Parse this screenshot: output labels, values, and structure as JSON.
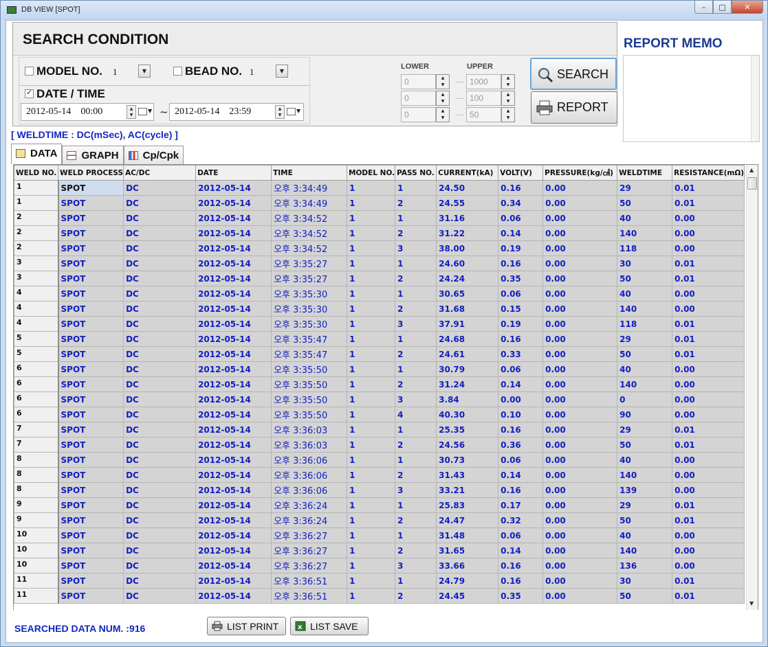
{
  "window": {
    "title": "DB VIEW [SPOT]",
    "minimize": "–",
    "maximize": "□",
    "close": "✕"
  },
  "search": {
    "title": "SEARCH CONDITION",
    "model_label": "MODEL NO.",
    "model_value": "1",
    "model_checked": false,
    "bead_label": "BEAD NO.",
    "bead_value": "1",
    "bead_checked": false,
    "datetime_label": "DATE / TIME",
    "datetime_checked": true,
    "from": "2012-05-14    00:00",
    "to": "2012-05-14    23:59",
    "tilde": "~",
    "lower_label": "LOWER",
    "upper_label": "UPPER",
    "lower": [
      "0",
      "0",
      "0"
    ],
    "upper": [
      "1000",
      "100",
      "50"
    ],
    "search_button": "SEARCH",
    "report_button": "REPORT"
  },
  "memo": {
    "title": "REPORT MEMO"
  },
  "weldtime_note": "[ WELDTIME : DC(mSec), AC(cycle) ]",
  "tabs": [
    "DATA",
    "GRAPH",
    "Cp/Cpk"
  ],
  "grid": {
    "columns": [
      "WELD NO.",
      "WELD PROCESS",
      "AC/DC",
      "DATE",
      "TIME",
      "MODEL NO.",
      "PASS NO.",
      "CURRENT(kA)",
      "VOLT(V)",
      "PRESSURE(kg/㎠)",
      "WELDTIME",
      "RESISTANCE(mΩ)"
    ],
    "rows": [
      [
        "1",
        "SPOT",
        "DC",
        "2012-05-14",
        "오후 3:34:49",
        "1",
        "1",
        "24.50",
        "0.16",
        "0.00",
        "29",
        "0.01"
      ],
      [
        "1",
        "SPOT",
        "DC",
        "2012-05-14",
        "오후 3:34:49",
        "1",
        "2",
        "24.55",
        "0.34",
        "0.00",
        "50",
        "0.01"
      ],
      [
        "2",
        "SPOT",
        "DC",
        "2012-05-14",
        "오후 3:34:52",
        "1",
        "1",
        "31.16",
        "0.06",
        "0.00",
        "40",
        "0.00"
      ],
      [
        "2",
        "SPOT",
        "DC",
        "2012-05-14",
        "오후 3:34:52",
        "1",
        "2",
        "31.22",
        "0.14",
        "0.00",
        "140",
        "0.00"
      ],
      [
        "2",
        "SPOT",
        "DC",
        "2012-05-14",
        "오후 3:34:52",
        "1",
        "3",
        "38.00",
        "0.19",
        "0.00",
        "118",
        "0.00"
      ],
      [
        "3",
        "SPOT",
        "DC",
        "2012-05-14",
        "오후 3:35:27",
        "1",
        "1",
        "24.60",
        "0.16",
        "0.00",
        "30",
        "0.01"
      ],
      [
        "3",
        "SPOT",
        "DC",
        "2012-05-14",
        "오후 3:35:27",
        "1",
        "2",
        "24.24",
        "0.35",
        "0.00",
        "50",
        "0.01"
      ],
      [
        "4",
        "SPOT",
        "DC",
        "2012-05-14",
        "오후 3:35:30",
        "1",
        "1",
        "30.65",
        "0.06",
        "0.00",
        "40",
        "0.00"
      ],
      [
        "4",
        "SPOT",
        "DC",
        "2012-05-14",
        "오후 3:35:30",
        "1",
        "2",
        "31.68",
        "0.15",
        "0.00",
        "140",
        "0.00"
      ],
      [
        "4",
        "SPOT",
        "DC",
        "2012-05-14",
        "오후 3:35:30",
        "1",
        "3",
        "37.91",
        "0.19",
        "0.00",
        "118",
        "0.01"
      ],
      [
        "5",
        "SPOT",
        "DC",
        "2012-05-14",
        "오후 3:35:47",
        "1",
        "1",
        "24.68",
        "0.16",
        "0.00",
        "29",
        "0.01"
      ],
      [
        "5",
        "SPOT",
        "DC",
        "2012-05-14",
        "오후 3:35:47",
        "1",
        "2",
        "24.61",
        "0.33",
        "0.00",
        "50",
        "0.01"
      ],
      [
        "6",
        "SPOT",
        "DC",
        "2012-05-14",
        "오후 3:35:50",
        "1",
        "1",
        "30.79",
        "0.06",
        "0.00",
        "40",
        "0.00"
      ],
      [
        "6",
        "SPOT",
        "DC",
        "2012-05-14",
        "오후 3:35:50",
        "1",
        "2",
        "31.24",
        "0.14",
        "0.00",
        "140",
        "0.00"
      ],
      [
        "6",
        "SPOT",
        "DC",
        "2012-05-14",
        "오후 3:35:50",
        "1",
        "3",
        "3.84",
        "0.00",
        "0.00",
        "0",
        "0.00"
      ],
      [
        "6",
        "SPOT",
        "DC",
        "2012-05-14",
        "오후 3:35:50",
        "1",
        "4",
        "40.30",
        "0.10",
        "0.00",
        "90",
        "0.00"
      ],
      [
        "7",
        "SPOT",
        "DC",
        "2012-05-14",
        "오후 3:36:03",
        "1",
        "1",
        "25.35",
        "0.16",
        "0.00",
        "29",
        "0.01"
      ],
      [
        "7",
        "SPOT",
        "DC",
        "2012-05-14",
        "오후 3:36:03",
        "1",
        "2",
        "24.56",
        "0.36",
        "0.00",
        "50",
        "0.01"
      ],
      [
        "8",
        "SPOT",
        "DC",
        "2012-05-14",
        "오후 3:36:06",
        "1",
        "1",
        "30.73",
        "0.06",
        "0.00",
        "40",
        "0.00"
      ],
      [
        "8",
        "SPOT",
        "DC",
        "2012-05-14",
        "오후 3:36:06",
        "1",
        "2",
        "31.43",
        "0.14",
        "0.00",
        "140",
        "0.00"
      ],
      [
        "8",
        "SPOT",
        "DC",
        "2012-05-14",
        "오후 3:36:06",
        "1",
        "3",
        "33.21",
        "0.16",
        "0.00",
        "139",
        "0.00"
      ],
      [
        "9",
        "SPOT",
        "DC",
        "2012-05-14",
        "오후 3:36:24",
        "1",
        "1",
        "25.83",
        "0.17",
        "0.00",
        "29",
        "0.01"
      ],
      [
        "9",
        "SPOT",
        "DC",
        "2012-05-14",
        "오후 3:36:24",
        "1",
        "2",
        "24.47",
        "0.32",
        "0.00",
        "50",
        "0.01"
      ],
      [
        "10",
        "SPOT",
        "DC",
        "2012-05-14",
        "오후 3:36:27",
        "1",
        "1",
        "31.48",
        "0.06",
        "0.00",
        "40",
        "0.00"
      ],
      [
        "10",
        "SPOT",
        "DC",
        "2012-05-14",
        "오후 3:36:27",
        "1",
        "2",
        "31.65",
        "0.14",
        "0.00",
        "140",
        "0.00"
      ],
      [
        "10",
        "SPOT",
        "DC",
        "2012-05-14",
        "오후 3:36:27",
        "1",
        "3",
        "33.66",
        "0.16",
        "0.00",
        "136",
        "0.00"
      ],
      [
        "11",
        "SPOT",
        "DC",
        "2012-05-14",
        "오후 3:36:51",
        "1",
        "1",
        "24.79",
        "0.16",
        "0.00",
        "30",
        "0.01"
      ],
      [
        "11",
        "SPOT",
        "DC",
        "2012-05-14",
        "오후 3:36:51",
        "1",
        "2",
        "24.45",
        "0.35",
        "0.00",
        "50",
        "0.01"
      ]
    ]
  },
  "footer": {
    "searched_label": "SEARCHED DATA NUM. :",
    "searched_count": "916",
    "list_print": "LIST PRINT",
    "list_save": "LIST SAVE"
  },
  "colors": {
    "data_text": "#1420c0",
    "title_blue": "#1b3a93",
    "cell_bg": "#d4d4d4"
  }
}
